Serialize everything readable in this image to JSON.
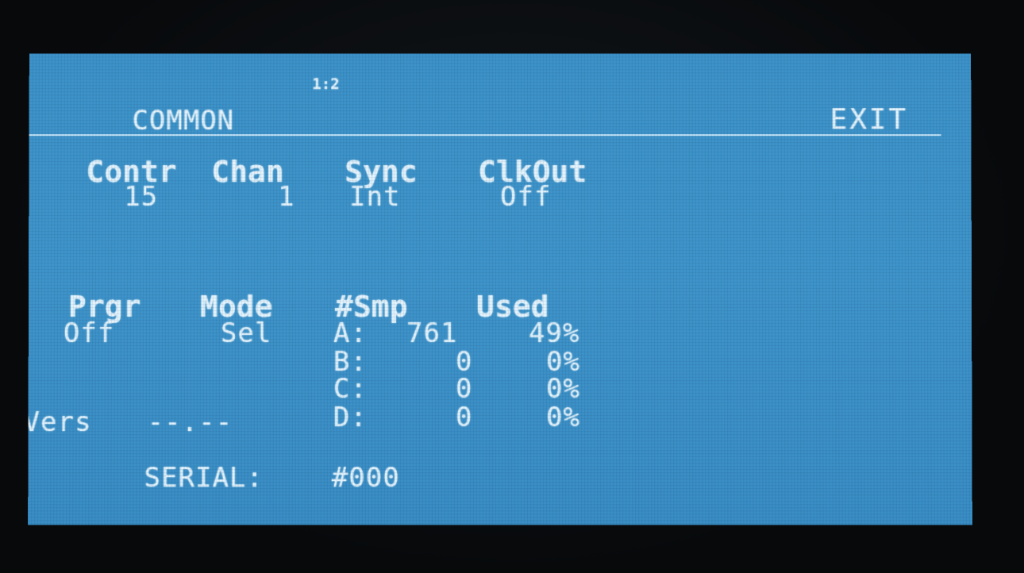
{
  "header": {
    "page_indicator": "1:2",
    "title": "COMMON",
    "exit_label": "EXIT"
  },
  "top_params": [
    {
      "label": "Contr",
      "value": "15"
    },
    {
      "label": "Chan",
      "value": "1"
    },
    {
      "label": "Sync",
      "value": "Int"
    },
    {
      "label": "ClkOut",
      "value": "Off"
    }
  ],
  "bottom_params": [
    {
      "label": "Prgr",
      "value": "Off"
    },
    {
      "label": "Mode",
      "value": "Sel"
    }
  ],
  "sample_table": {
    "smp_header": "#Smp",
    "used_header": "Used",
    "rows": [
      {
        "bank": "A:",
        "count": "761",
        "used": "49%"
      },
      {
        "bank": "B:",
        "count": "0",
        "used": "0%"
      },
      {
        "bank": "C:",
        "count": "0",
        "used": "0%"
      },
      {
        "bank": "D:",
        "count": "0",
        "used": "0%"
      }
    ]
  },
  "version": {
    "label": "Vers",
    "value": "--.--"
  },
  "serial": {
    "label": "SERIAL:",
    "value": "#000"
  },
  "colors": {
    "screen": "#3f95cb",
    "text": "#e6f6ff",
    "bezel": "#07090b"
  }
}
